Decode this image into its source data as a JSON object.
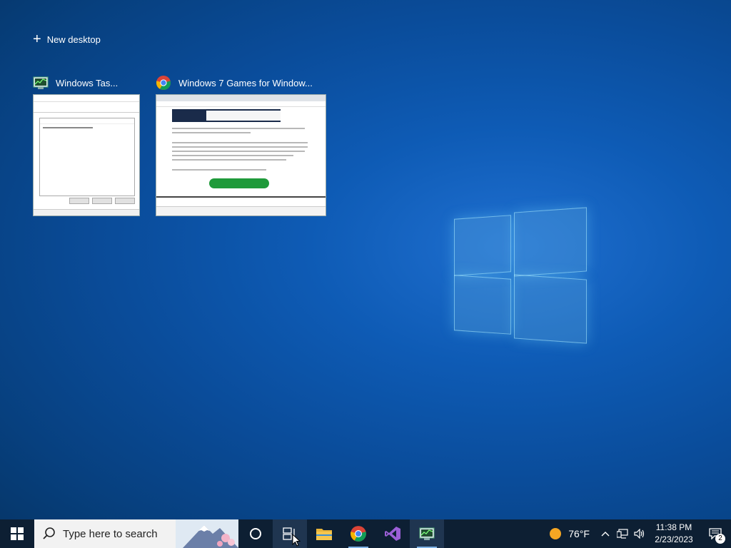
{
  "task_view": {
    "new_desktop_label": "New desktop",
    "windows": [
      {
        "title": "Windows Tas...",
        "icon": "task-manager-icon"
      },
      {
        "title": "Windows 7 Games for Window...",
        "icon": "chrome-icon"
      }
    ]
  },
  "taskbar": {
    "search_placeholder": "Type here to search",
    "pinned": [
      {
        "name": "cortana",
        "icon": "cortana-icon"
      },
      {
        "name": "task-view",
        "icon": "task-view-icon"
      },
      {
        "name": "file-explorer",
        "icon": "file-explorer-icon"
      },
      {
        "name": "chrome",
        "icon": "chrome-icon"
      },
      {
        "name": "visual-studio",
        "icon": "visual-studio-icon"
      },
      {
        "name": "task-manager",
        "icon": "task-manager-icon"
      }
    ],
    "weather": {
      "temp": "76°F"
    },
    "clock": {
      "time": "11:38 PM",
      "date": "2/23/2023"
    },
    "notifications": {
      "count": "2"
    }
  },
  "colors": {
    "desktop_bg": "#0a4c9a",
    "taskbar_bg": "#0d1f33",
    "download_button": "#1f9a3a"
  }
}
